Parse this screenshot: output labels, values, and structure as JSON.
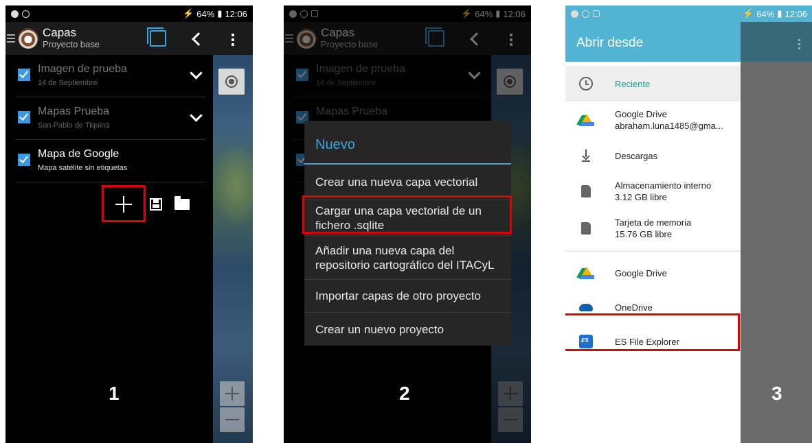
{
  "status": {
    "battery": "64%",
    "time": "12:06"
  },
  "panel1": {
    "app_title": "Capas",
    "app_subtitle": "Proyecto base",
    "layers": [
      {
        "name": "Imagen de prueba",
        "subtitle": "14 de Septiembre",
        "checked": true
      },
      {
        "name": "Mapas Prueba",
        "subtitle": "San Pablo de Tiquina",
        "checked": true
      },
      {
        "name": "Mapa de Google",
        "subtitle": "Mapa satélite sin etiquetas",
        "checked": true
      }
    ],
    "step": "1"
  },
  "panel2": {
    "dialog_title": "Nuevo",
    "options": [
      "Crear una nueva capa vectorial",
      "Cargar una capa vectorial de un fichero .sqlite",
      "Añadir una nueva capa del repositorio cartográfico del ITACyL",
      "Importar capas de otro proyecto",
      "Crear un nuevo proyecto"
    ],
    "step": "2"
  },
  "panel3": {
    "title": "Abrir desde",
    "items": [
      {
        "label": "Reciente",
        "sub": "",
        "icon": "clock-icon"
      },
      {
        "label": "Google Drive",
        "sub": "abraham.luna1485@gma...",
        "icon": "google-drive-icon"
      },
      {
        "label": "Descargas",
        "sub": "",
        "icon": "download-icon"
      },
      {
        "label": "Almacenamiento interno",
        "sub": "3.12 GB libre",
        "icon": "sd-card-icon"
      },
      {
        "label": "Tarjeta de memoria",
        "sub": "15.76 GB libre",
        "icon": "sd-card-icon"
      },
      {
        "label": "Google Drive",
        "sub": "",
        "icon": "google-drive-icon"
      },
      {
        "label": "OneDrive",
        "sub": "",
        "icon": "onedrive-icon"
      },
      {
        "label": "ES File Explorer",
        "sub": "",
        "icon": "es-file-explorer-icon"
      }
    ],
    "step": "3"
  },
  "colors": {
    "accent_blue": "#3ca6e0",
    "highlight_red": "#e00000",
    "drawer_header": "#52b3d3",
    "selected_teal": "#1d9c8a"
  }
}
